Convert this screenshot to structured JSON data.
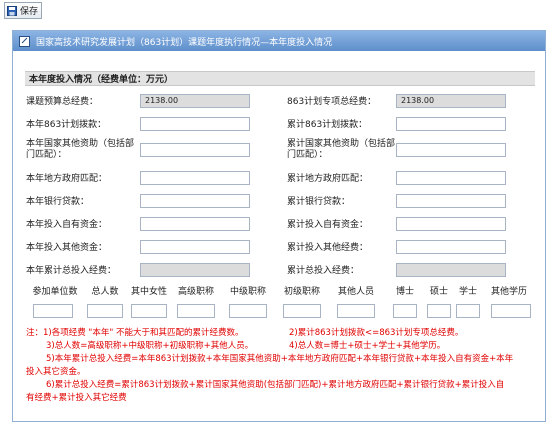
{
  "toolbar": {
    "save_label": "保存"
  },
  "panel": {
    "title": "国家高技术研究发展计划（863计划）课题年度执行情况—本年度投入情况",
    "section_title": "本年度投入情况（经费单位：万元）"
  },
  "fields": {
    "budget_total_label": "课题预算总经费：",
    "budget_total_value": "2138.00",
    "special_total_label": "863计划专项总经费：",
    "special_total_value": "2138.00",
    "y863_label": "本年863计划拨款：",
    "cum863_label": "累计863计划拨款：",
    "y_other_nat_label": "本年国家其他资助（包括部门匹配）：",
    "cum_other_nat_label": "累计国家其他资助（包括部门匹配）：",
    "y_local_label": "本年地方政府匹配：",
    "cum_local_label": "累计地方政府匹配：",
    "y_bank_label": "本年银行贷款：",
    "cum_bank_label": "累计银行贷款：",
    "y_self_label": "本年投入自有资金：",
    "cum_self_label": "累计投入自有资金：",
    "y_otherfund_label": "本年投入其他资金：",
    "cum_otherfund_label": "累计投入其他经费：",
    "y_total_label": "本年累计总投入经费：",
    "cum_total_label": "累计总投入经费："
  },
  "staff_columns": [
    "参加单位数",
    "总人数",
    "其中女性",
    "高级职称",
    "中级职称",
    "初级职称",
    "其他人员",
    "博士",
    "硕士",
    "学士",
    "其他学历"
  ],
  "notes": {
    "n1": "注：1)各项经费 \"本年\" 不能大于和其匹配的累计经费数。",
    "n2": "2)累计863计划拨款<=863计划专项总经费。",
    "n3": "3)总人数=高级职称+中级职称+初级职称+其他人员。",
    "n4": "4)总人数=博士+硕士+学士+其他学历。",
    "n5a": "5)本年累计总投入经费=本年863计划拨款+本年国家其他资助+本年地方政府匹配+本年银行贷款+本年投入自有资金+本年",
    "n5b": "投入其它资金。",
    "n6a": "6)累计总投入经费=累计863计划拨款+累计国家其他资助(包括部门匹配)+累计地方政府匹配+累计银行贷款+累计投入自",
    "n6b": "有经费+累计投入其它经费"
  }
}
